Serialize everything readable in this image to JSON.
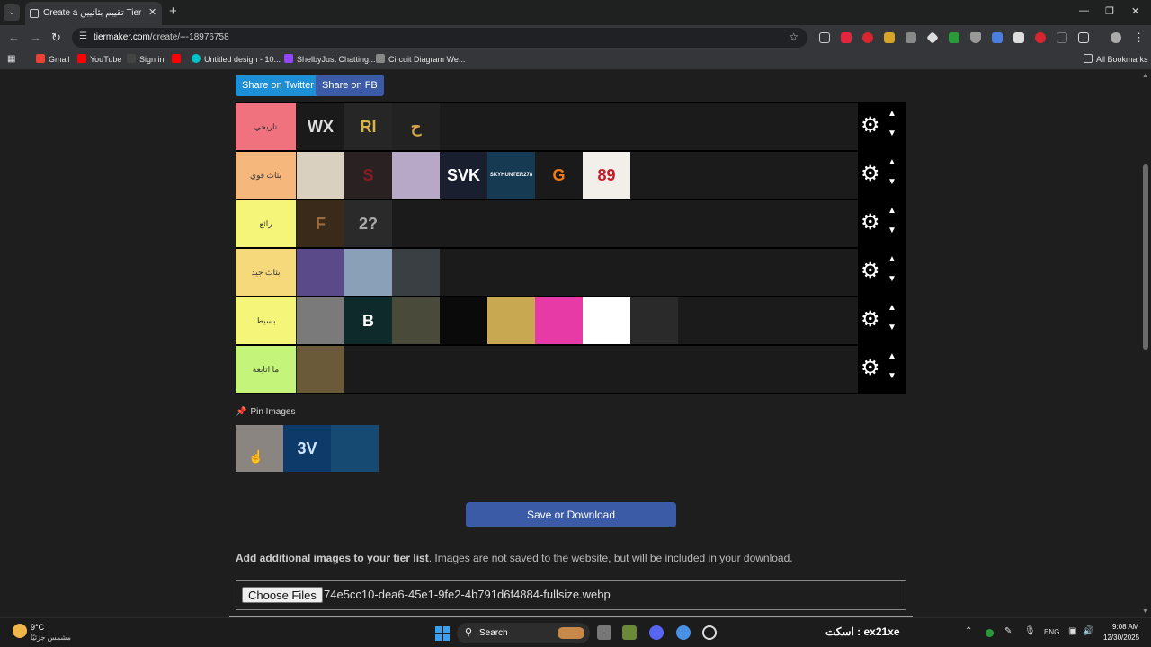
{
  "browser": {
    "tab_title": "Create a تقييم بثاثيين Tier List - T",
    "new_tab": "+",
    "url_host": "tiermaker.com",
    "url_path": "/create/---18976758",
    "bookmarks": [
      {
        "label": "Gmail",
        "color": "#ea4335"
      },
      {
        "label": "YouTube",
        "color": "#ff0000"
      },
      {
        "label": "Sign in",
        "color": "#444444"
      },
      {
        "label": "",
        "color": "#ff0000"
      },
      {
        "label": "Untitled design - 10...",
        "color": "#00c4cc"
      },
      {
        "label": "ShelbyJust Chatting...",
        "color": "#9146ff"
      },
      {
        "label": "Circuit Diagram We...",
        "color": "#888888"
      }
    ],
    "all_bookmarks": "All Bookmarks"
  },
  "page": {
    "share_twitter": "Share on Twitter",
    "share_fb": "Share on FB",
    "tiers": [
      {
        "label": "تاريخي",
        "color": "#f0727e",
        "items": [
          {
            "text": "WX",
            "bg": "#1a1a1a",
            "fg": "#dddddd"
          },
          {
            "text": "RI",
            "bg": "#262626",
            "fg": "#d6b44c"
          },
          {
            "text": "ح",
            "bg": "#222222",
            "fg": "#d4a84a"
          }
        ]
      },
      {
        "label": "بثاث قوي",
        "color": "#f6b77c",
        "items": [
          {
            "text": "",
            "bg": "#d9d0c0",
            "fg": "#222222"
          },
          {
            "text": "S",
            "bg": "#2a2222",
            "fg": "#8a1a22"
          },
          {
            "text": "",
            "bg": "#b8a8c8",
            "fg": "#333333"
          },
          {
            "text": "SVK",
            "bg": "#1a1f30",
            "fg": "#ffffff"
          },
          {
            "text": "SKYHUNTER278",
            "bg": "#163a52",
            "fg": "#ffffff"
          },
          {
            "text": "G",
            "bg": "#1a1a1a",
            "fg": "#f07a18"
          },
          {
            "text": "89",
            "bg": "#f2eeea",
            "fg": "#c41a2a"
          }
        ]
      },
      {
        "label": "رائع",
        "color": "#f5f57a",
        "items": [
          {
            "text": "F",
            "bg": "#3a2a1a",
            "fg": "#a06a3a"
          },
          {
            "text": "2?",
            "bg": "#2a2a2a",
            "fg": "#aaaaaa"
          }
        ]
      },
      {
        "label": "بثاث جيد",
        "color": "#f6d97a",
        "items": [
          {
            "text": "",
            "bg": "#5a4a8a",
            "fg": "#ffffff"
          },
          {
            "text": "",
            "bg": "#8aa0b8",
            "fg": "#ffffff"
          },
          {
            "text": "",
            "bg": "#3a3f44",
            "fg": "#ffffff"
          }
        ]
      },
      {
        "label": "بسيط",
        "color": "#f5f57a",
        "items": [
          {
            "text": "",
            "bg": "#7a7a7a",
            "fg": "#ffffff"
          },
          {
            "text": "B",
            "bg": "#0e2a2a",
            "fg": "#ffffff"
          },
          {
            "text": "",
            "bg": "#4a4a3a",
            "fg": "#ffffff"
          },
          {
            "text": "",
            "bg": "#0a0a0a",
            "fg": "#ffffff"
          },
          {
            "text": "",
            "bg": "#c8a850",
            "fg": "#ffffff"
          },
          {
            "text": "",
            "bg": "#e83aa6",
            "fg": "#ffffff"
          },
          {
            "text": "",
            "bg": "#ffffff",
            "fg": "#000000"
          },
          {
            "text": "",
            "bg": "#2a2a2a",
            "fg": "#ffffff"
          }
        ]
      },
      {
        "label": "ما اتابعه",
        "color": "#c4f57a",
        "items": [
          {
            "text": "",
            "bg": "#6a5a3a",
            "fg": "#ffffff"
          }
        ]
      }
    ],
    "pin_label": "Pin Images",
    "pin_items": [
      {
        "text": "",
        "bg": "#8a8580"
      },
      {
        "text": "3V",
        "bg": "#0e3a6a"
      },
      {
        "text": "",
        "bg": "#164a72"
      }
    ],
    "save_label": "Save or Download",
    "add_bold": "Add additional images to your tier list",
    "add_rest": ". Images are not saved to the website, but will be included in your download.",
    "choose_files": "Choose Files",
    "file_name": "74e5cc10-dea6-45e1-9fe2-4b791d6f4884-fullsize.webp"
  },
  "taskbar": {
    "temp": "9°C",
    "weather": "مشمس جزئيًا",
    "search": "Search",
    "ticker": "اسكت : ex21xe",
    "lang": "ENG",
    "time": "9:08 AM",
    "date": "12/30/2025"
  }
}
